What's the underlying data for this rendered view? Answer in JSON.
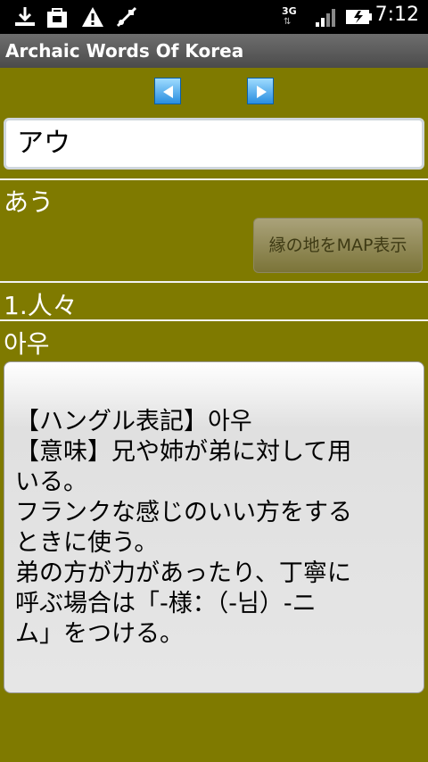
{
  "status": {
    "time": "7:12",
    "network": "3G",
    "icons": [
      "download-icon",
      "bag-icon",
      "warning-icon",
      "usb-debug-icon",
      "signal-icon",
      "battery-charging-icon"
    ]
  },
  "app": {
    "title": "Archaic Words Of Korea"
  },
  "nav": {
    "prev_icon": "left-arrow-icon",
    "next_icon": "right-arrow-icon"
  },
  "search": {
    "value": "アウ"
  },
  "entry": {
    "reading": "あう",
    "map_button": "縁の地をMAP表示",
    "meaning_number": "1.人々",
    "hangul": "아우",
    "detail_lines": [
      "【ハングル表記】아우",
      "【意味】兄や姉が弟に対して用",
      "いる。",
      "フランクな感じのいい方をする",
      "ときに使う。",
      "弟の方が力があったり、丁寧に",
      "呼ぶ場合は「-様：（-님）-ニ",
      "ム」をつける。"
    ]
  },
  "colors": {
    "background": "#7f7a00",
    "button": "#8d8760"
  }
}
